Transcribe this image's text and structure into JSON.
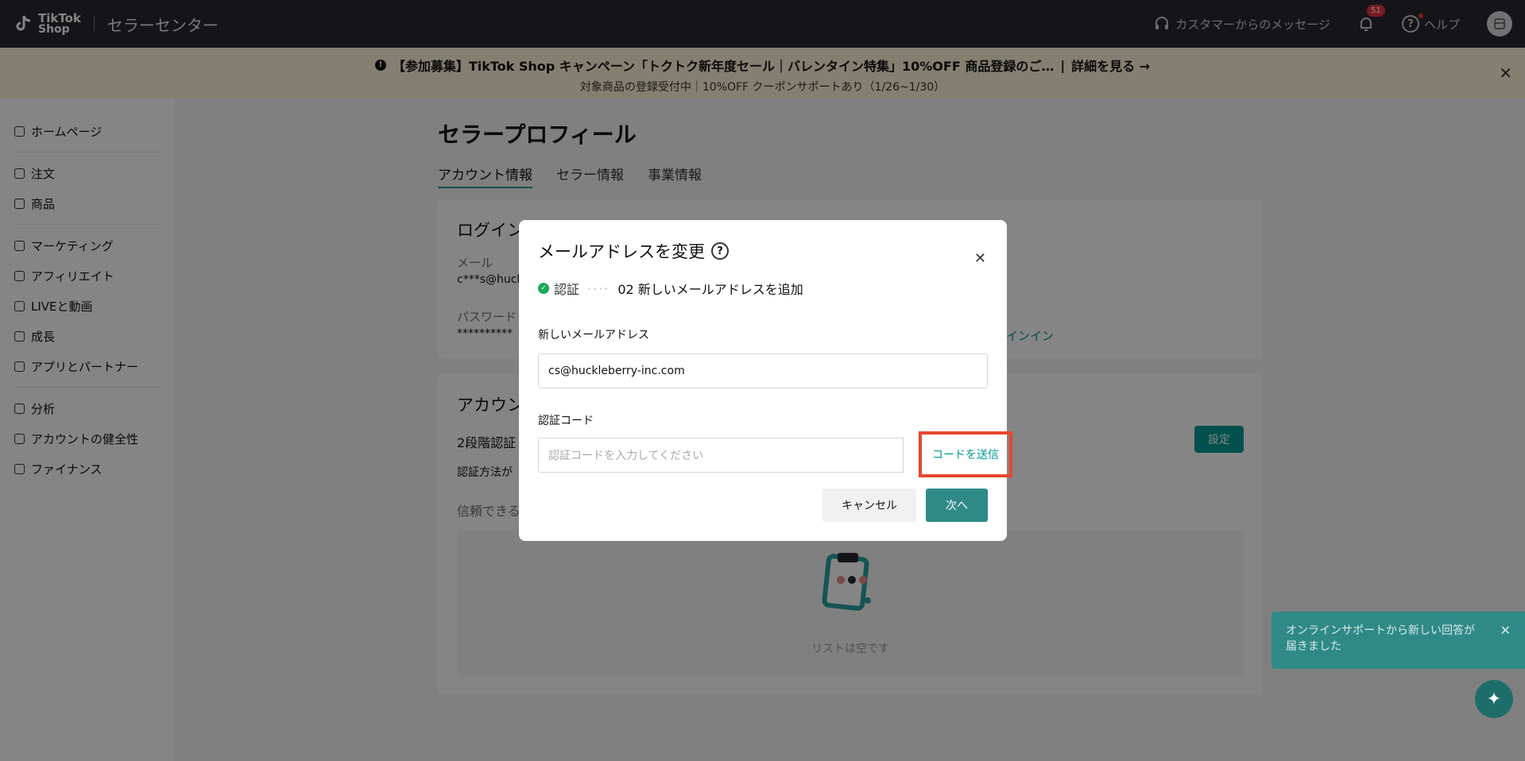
{
  "topbar": {
    "logo_line1": "TikTok",
    "logo_line2": "Shop",
    "title": "セラーセンター",
    "messages_label": "カスタマーからのメッセージ",
    "notifications_count": "51",
    "help_label": "ヘルプ"
  },
  "announcement": {
    "line1": "【参加募集】TikTok Shop キャンペーン「トクトク新年度セール｜バレンタイン特集」10%OFF 商品登録のご…",
    "link": "詳細を見る →",
    "separator": "|",
    "line2": "対象商品の登録受付中｜10%OFF クーポンサポートあり（1/26~1/30）"
  },
  "sidebar": {
    "items": [
      {
        "label": "ホームページ",
        "icon": "home-icon"
      },
      {
        "label": "注文",
        "icon": "order-icon"
      },
      {
        "label": "商品",
        "icon": "product-icon"
      },
      {
        "label": "マーケティング",
        "icon": "megaphone-icon"
      },
      {
        "label": "アフィリエイト",
        "icon": "people-icon"
      },
      {
        "label": "LIVEと動画",
        "icon": "video-icon"
      },
      {
        "label": "成長",
        "icon": "medal-icon"
      },
      {
        "label": "アプリとパートナー",
        "icon": "apps-icon"
      },
      {
        "label": "分析",
        "icon": "chart-icon"
      },
      {
        "label": "アカウントの健全性",
        "icon": "trophy-icon"
      },
      {
        "label": "ファイナンス",
        "icon": "wallet-icon"
      }
    ]
  },
  "page": {
    "title": "セラープロフィール",
    "tabs": [
      "アカウント情報",
      "セラー情報",
      "事業情報"
    ],
    "login_card": {
      "heading": "ログイン",
      "email_label": "メール",
      "email_value": "c***s@huck",
      "password_label": "パスワード",
      "password_value": "**********",
      "signin_link": "サインイン"
    },
    "account_card": {
      "heading": "アカウン",
      "twofa_label": "2段階認証",
      "method_label": "認証方法が",
      "set_button": "設定",
      "trusted_label": "信頼できる",
      "empty_text": "リストは空です"
    }
  },
  "modal": {
    "title": "メールアドレスを変更",
    "step1": "認証",
    "step_dots": "····",
    "step2": "02 新しいメールアドレスを追加",
    "email_label": "新しいメールアドレス",
    "email_value": "cs@huckleberry-inc.com",
    "code_label": "認証コード",
    "code_placeholder": "認証コードを入力してください",
    "send_code": "コードを送信",
    "cancel": "キャンセル",
    "next": "次へ"
  },
  "toast": {
    "message": "オンラインサポートから新しい回答が届きました"
  }
}
